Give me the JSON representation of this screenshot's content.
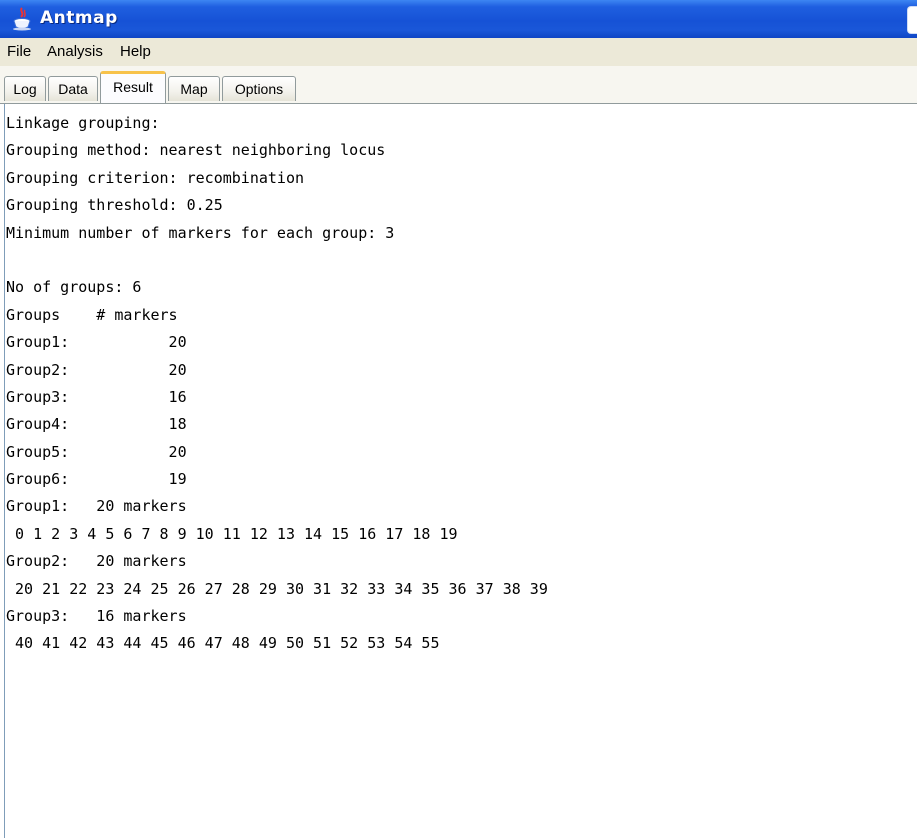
{
  "window": {
    "title": "Antmap",
    "app_icon": "java-cup-icon"
  },
  "menu": [
    "File",
    "Analysis",
    "Help"
  ],
  "tabs": [
    "Log",
    "Data",
    "Result",
    "Map",
    "Options"
  ],
  "active_tab": "Result",
  "result": {
    "lines": [
      "Linkage grouping:",
      "Grouping method: nearest neighboring locus",
      "Grouping criterion: recombination",
      "Grouping threshold: 0.25",
      "Minimum number of markers for each group: 3",
      "",
      "No of groups: 6",
      "Groups    # markers",
      "Group1:           20",
      "Group2:           20",
      "Group3:           16",
      "Group4:           18",
      "Group5:           20",
      "Group6:           19",
      "Group1:   20 markers",
      " 0 1 2 3 4 5 6 7 8 9 10 11 12 13 14 15 16 17 18 19",
      "Group2:   20 markers",
      " 20 21 22 23 24 25 26 27 28 29 30 31 32 33 34 35 36 37 38 39",
      "Group3:   16 markers",
      " 40 41 42 43 44 45 46 47 48 49 50 51 52 53 54 55"
    ]
  }
}
